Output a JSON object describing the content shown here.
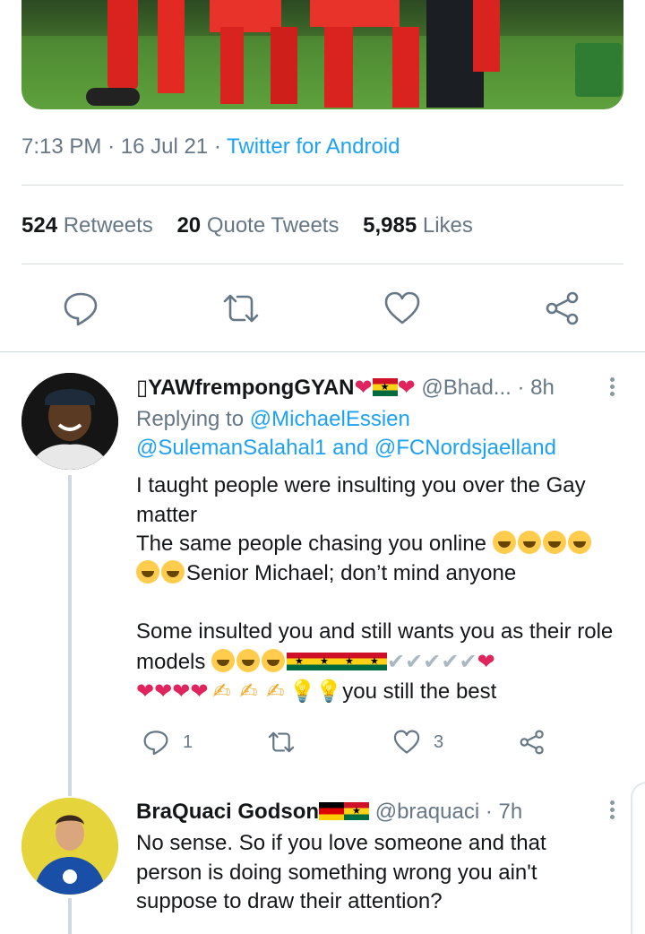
{
  "tweet": {
    "time": "7:13 PM",
    "date": "16 Jul 21",
    "separator": "·",
    "source": "Twitter for Android",
    "retweets_count": "524",
    "retweets_label": "Retweets",
    "quotes_count": "20",
    "quotes_label": "Quote Tweets",
    "likes_count": "5,985",
    "likes_label": "Likes"
  },
  "icons": {
    "reply": "reply-icon",
    "retweet": "retweet-icon",
    "like": "heart-icon",
    "share": "share-icon",
    "more": "more-vertical-icon"
  },
  "colors": {
    "link": "#1da1f2",
    "secondary_text": "#657786",
    "divider": "#cfd9de"
  },
  "replies": [
    {
      "glyph_prefix": "▯",
      "name": "YAWfrempongGYAN",
      "handle": "@Bhad...",
      "time": "8h",
      "replying_prefix": "Replying to",
      "replying_to_1": "@MichaelEssien",
      "replying_to_2": "@SulemanSalahal1",
      "replying_and": "and",
      "replying_to_3": "@FCNordsjaelland",
      "line1": "I taught people were insulting you over the Gay matter",
      "line2": "The same people chasing you online",
      "line3": "Senior Michael; don’t mind anyone",
      "line4": "Some insulted you and still wants you as their role models",
      "line5": "you still the best",
      "reply_count": "1",
      "like_count": "3"
    },
    {
      "name": "BraQuaci Godson",
      "handle": "@braquaci",
      "time": "7h",
      "text": "No sense. So if you love someone and that person is doing something wrong you ain't suppose to draw their attention?"
    }
  ]
}
